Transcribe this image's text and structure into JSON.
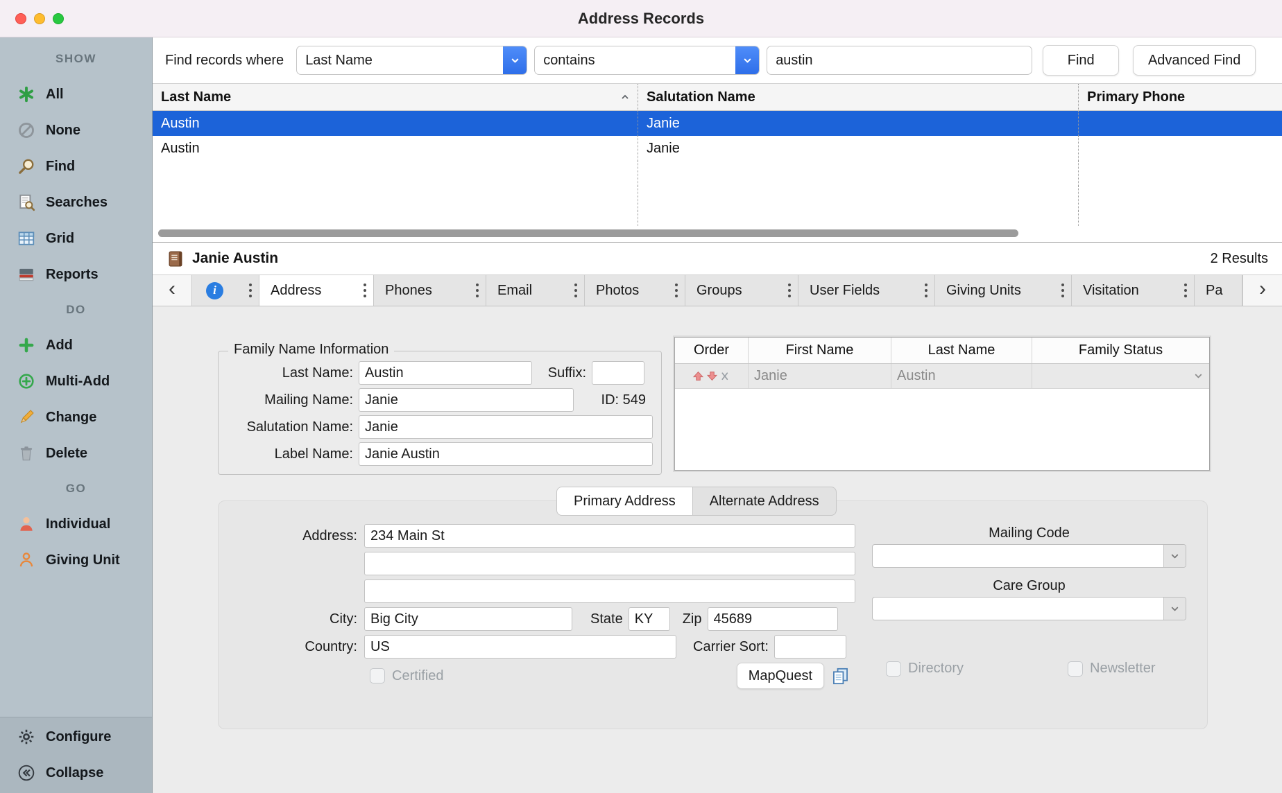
{
  "window": {
    "title": "Address Records"
  },
  "sidebar": {
    "show_header": "SHOW",
    "all": "All",
    "none": "None",
    "find": "Find",
    "searches": "Searches",
    "grid": "Grid",
    "reports": "Reports",
    "do_header": "DO",
    "add": "Add",
    "multi_add": "Multi-Add",
    "change": "Change",
    "delete": "Delete",
    "go_header": "GO",
    "individual": "Individual",
    "giving_unit": "Giving Unit",
    "configure": "Configure",
    "collapse": "Collapse"
  },
  "find_bar": {
    "label": "Find records where",
    "field": "Last Name",
    "operator": "contains",
    "query": "austin",
    "find_button": "Find",
    "advanced_find_button": "Advanced Find"
  },
  "results": {
    "columns": [
      "Last Name",
      "Salutation Name",
      "Primary Phone"
    ],
    "rows": [
      {
        "last_name": "Austin",
        "salutation_name": "Janie",
        "primary_phone": ""
      },
      {
        "last_name": "Austin",
        "salutation_name": "Janie",
        "primary_phone": ""
      }
    ],
    "count": "2 Results"
  },
  "record_header": {
    "name": "Janie Austin"
  },
  "tabs": {
    "address": "Address",
    "phones": "Phones",
    "email": "Email",
    "photos": "Photos",
    "groups": "Groups",
    "user_fields": "User Fields",
    "giving_units": "Giving Units",
    "visitation": "Visitation",
    "truncated": "Pa"
  },
  "family_info": {
    "title": "Family Name Information",
    "last_name_label": "Last Name:",
    "last_name": "Austin",
    "suffix_label": "Suffix:",
    "suffix": "",
    "mailing_name_label": "Mailing Name:",
    "mailing_name": "Janie",
    "id_text": "ID: 549",
    "salutation_name_label": "Salutation Name:",
    "salutation_name": "Janie",
    "label_name_label": "Label Name:",
    "label_name": "Janie Austin"
  },
  "members_table": {
    "columns": [
      "Order",
      "First Name",
      "Last Name",
      "Family Status"
    ],
    "rows": [
      {
        "first_name": "Janie",
        "last_name": "Austin",
        "family_status": ""
      }
    ]
  },
  "address_section": {
    "primary_tab": "Primary Address",
    "alternate_tab": "Alternate Address",
    "address_label": "Address:",
    "address_line1": "234 Main St",
    "address_line2": "",
    "address_line3": "",
    "city_label": "City:",
    "city": "Big City",
    "state_label": "State",
    "state": "KY",
    "zip_label": "Zip",
    "zip": "45689",
    "country_label": "Country:",
    "country": "US",
    "carrier_sort_label": "Carrier Sort:",
    "carrier_sort": "",
    "certified_label": "Certified",
    "mapquest_button": "MapQuest",
    "mailing_code_label": "Mailing Code",
    "care_group_label": "Care Group",
    "directory_label": "Directory",
    "newsletter_label": "Newsletter"
  },
  "colors": {
    "accent_blue": "#2e6ee9",
    "selection_blue": "#1c63d9",
    "sidebar_bg": "#b6c2ca",
    "titlebar_bg": "#f5eff4"
  }
}
